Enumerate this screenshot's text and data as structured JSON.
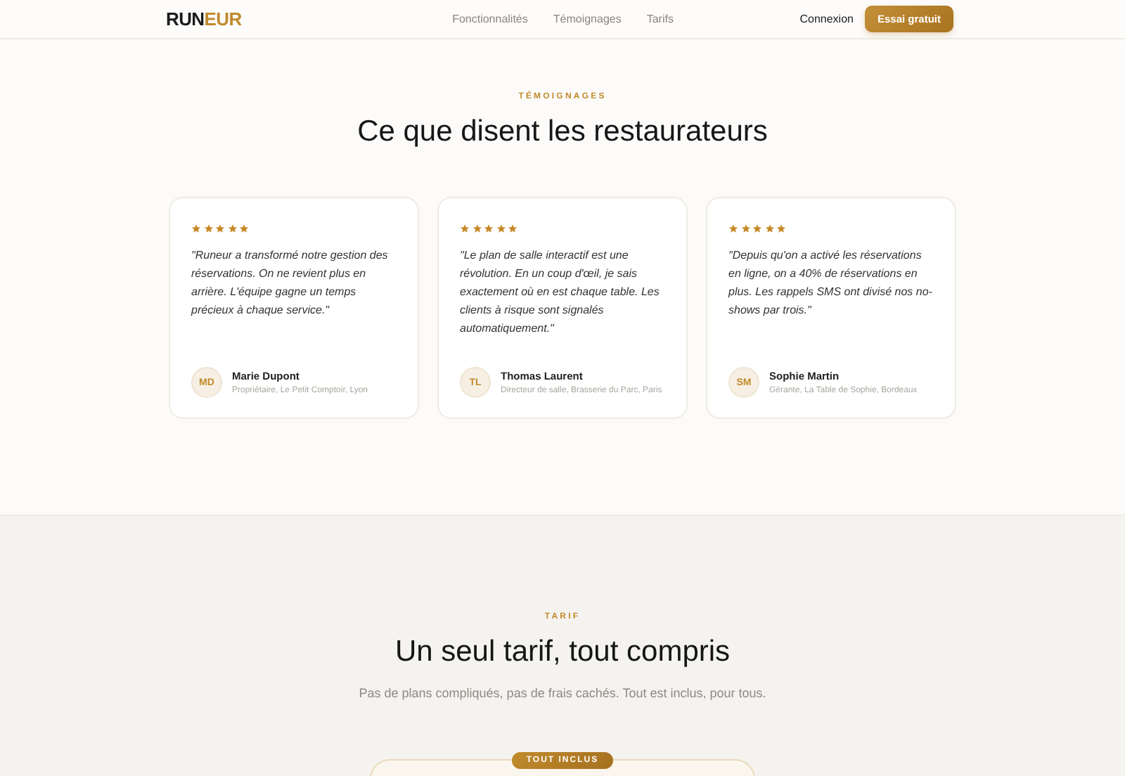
{
  "header": {
    "logo": {
      "part_1": "RUN",
      "part_2": "EUR"
    },
    "nav": [
      "Fonctionnalités",
      "Témoignages",
      "Tarifs"
    ],
    "login": "Connexion",
    "cta": "Essai gratuit"
  },
  "testimonials": {
    "eyebrow": "TÉMOIGNAGES",
    "title": "Ce que disent les restaurateurs",
    "items": [
      {
        "stars": 5,
        "quote": "\"Runeur a transformé notre gestion des réservations. On ne revient plus en arrière. L'équipe gagne un temps précieux à chaque service.\"",
        "initials": "MD",
        "name": "Marie Dupont",
        "role": "Propriétaire, Le Petit Comptoir, Lyon"
      },
      {
        "stars": 5,
        "quote": "\"Le plan de salle interactif est une révolution. En un coup d'œil, je sais exactement où en est chaque table. Les clients à risque sont signalés automatiquement.\"",
        "initials": "TL",
        "name": "Thomas Laurent",
        "role": "Directeur de salle, Brasserie du Parc, Paris"
      },
      {
        "stars": 5,
        "quote": "\"Depuis qu'on a activé les réservations en ligne, on a 40% de réservations en plus. Les rappels SMS ont divisé nos no-shows par trois.\"",
        "initials": "SM",
        "name": "Sophie Martin",
        "role": "Gérante, La Table de Sophie, Bordeaux"
      }
    ]
  },
  "pricing": {
    "eyebrow": "TARIF",
    "title": "Un seul tarif, tout compris",
    "subtitle": "Pas de plans compliqués, pas de frais cachés. Tout est inclus, pour tous.",
    "badge": "TOUT INCLUS"
  }
}
